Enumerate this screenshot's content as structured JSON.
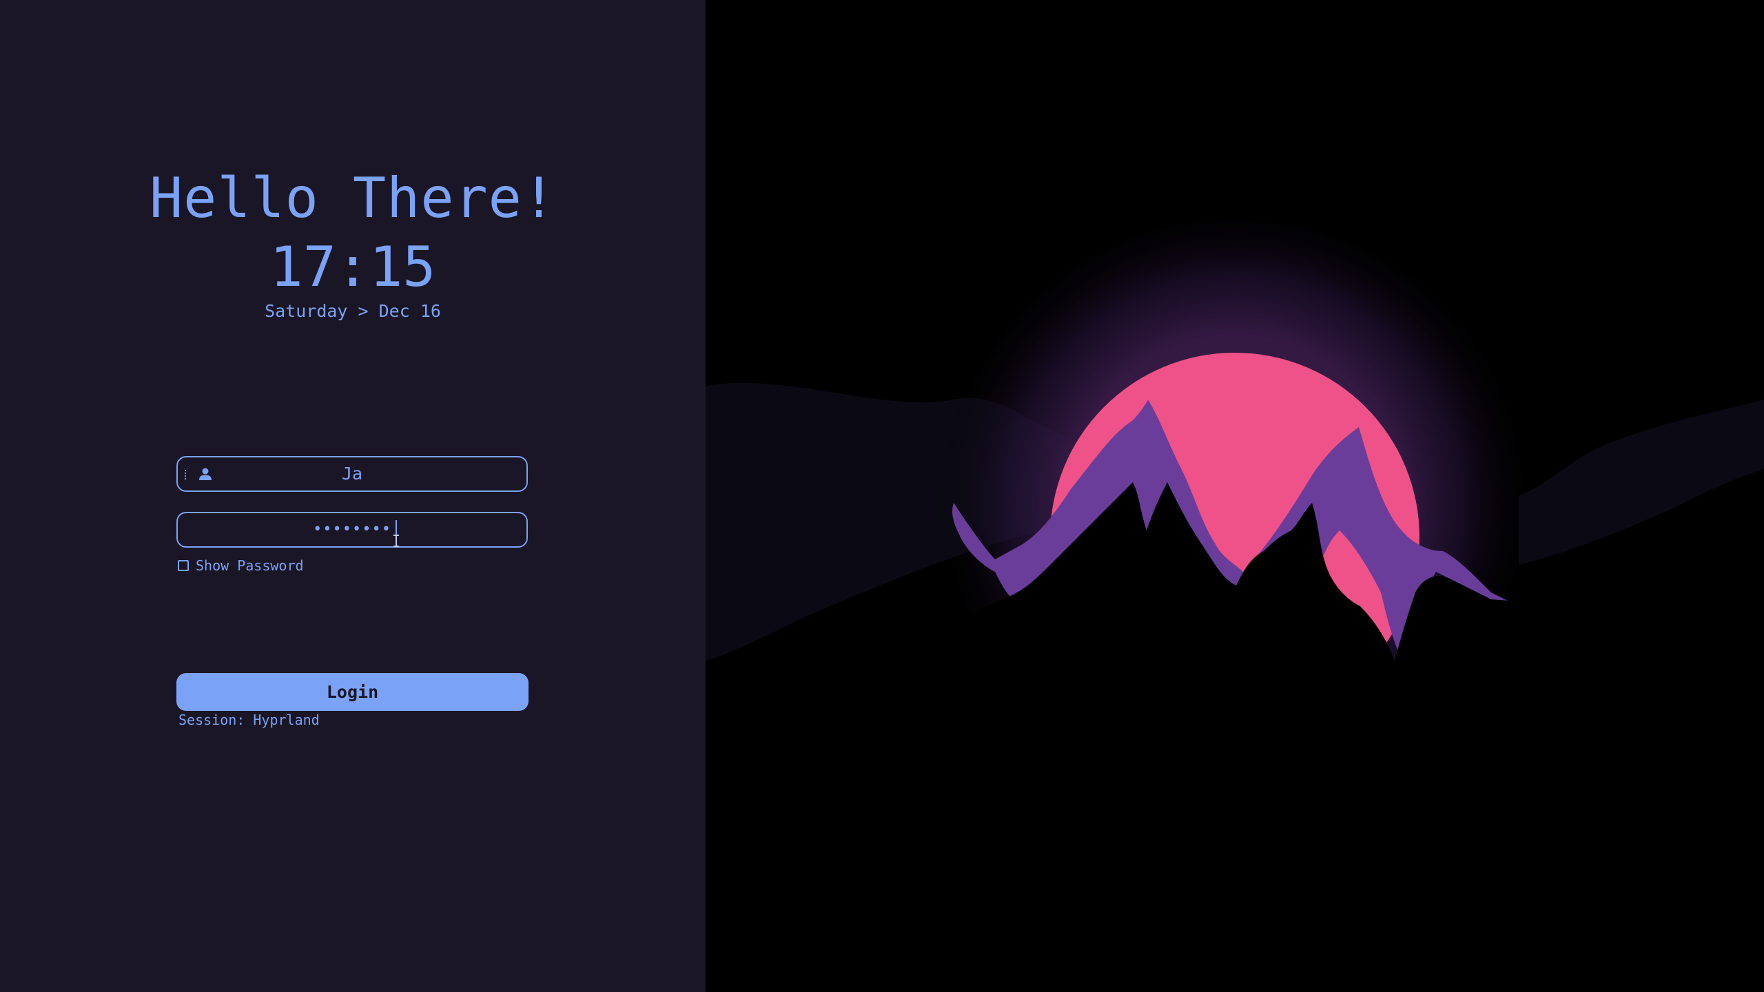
{
  "greeting": "Hello There!",
  "clock": "17:15",
  "date": "Saturday > Dec 16",
  "username": {
    "value": "Ja",
    "icon": "user-icon"
  },
  "password": {
    "masked_value": "••••••••"
  },
  "show_password": {
    "label": "Show Password",
    "checked": false
  },
  "login_button": {
    "label": "Login"
  },
  "session": {
    "label": "Session: Hyprland"
  },
  "colors": {
    "accent": "#7aa2f7",
    "panel_background": "#1a1625",
    "wallpaper_background": "#000000",
    "sun": "#ef5289",
    "mountain_highlight": "#6a3d9a"
  }
}
